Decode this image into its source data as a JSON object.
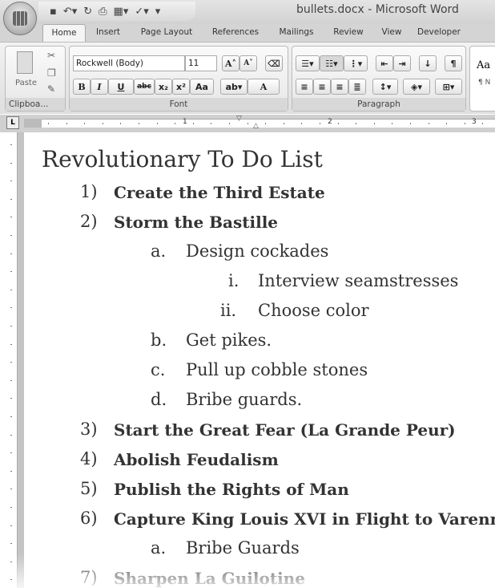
{
  "window": {
    "title": "bullets.docx - Microsoft Word"
  },
  "tabs": [
    "Home",
    "Insert",
    "Page Layout",
    "References",
    "Mailings",
    "Review",
    "View",
    "Developer"
  ],
  "ribbon": {
    "clipboard": {
      "label": "Clipboa...",
      "paste": "Paste"
    },
    "font": {
      "label": "Font",
      "font_name": "Rockwell (Body)",
      "font_size": "11",
      "bold": "B",
      "italic": "I",
      "underline": "U",
      "strike": "abc",
      "subscript": "x₂",
      "superscript": "x²",
      "change_case": "Aa",
      "grow": "A˄",
      "shrink": "A˅",
      "font_color": "A"
    },
    "paragraph": {
      "label": "Paragraph",
      "show_marks": "¶"
    },
    "styles": {
      "preview": "Aa",
      "sub": "¶ N"
    }
  },
  "ruler": {
    "marks": [
      "1",
      "2",
      "3"
    ]
  },
  "document": {
    "title": "Revolutionary To Do List",
    "items": [
      {
        "num": "1)",
        "text": "Create the Third Estate",
        "level": 0
      },
      {
        "num": "2)",
        "text": "Storm the Bastille",
        "level": 0
      },
      {
        "num": "a.",
        "text": "Design cockades",
        "level": 1
      },
      {
        "num": "i.",
        "text": "Interview seamstresses",
        "level": 2
      },
      {
        "num": "ii.",
        "text": "Choose color",
        "level": 2
      },
      {
        "num": "b.",
        "text": "Get pikes.",
        "level": 1
      },
      {
        "num": "c.",
        "text": "Pull up cobble stones",
        "level": 1
      },
      {
        "num": "d.",
        "text": "Bribe guards.",
        "level": 1
      },
      {
        "num": "3)",
        "text": "Start the Great Fear (La Grande Peur)",
        "level": 0
      },
      {
        "num": "4)",
        "text": "Abolish Feudalism",
        "level": 0
      },
      {
        "num": "5)",
        "text": "Publish  the Rights of Man",
        "level": 0
      },
      {
        "num": "6)",
        "text": "Capture King Louis XVI in Flight to Varennes",
        "level": 0
      },
      {
        "num": "a.",
        "text": "Bribe Guards",
        "level": 1
      },
      {
        "num": "7)",
        "text": "Sharpen La Guilotine",
        "level": 0
      }
    ]
  }
}
